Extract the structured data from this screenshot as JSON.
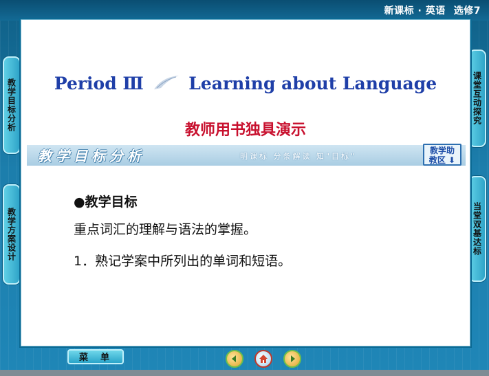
{
  "header": {
    "course": "新课标 · 英语",
    "module": "选修7"
  },
  "side_tabs": {
    "left": [
      "教学目标分析",
      "教学方案设计"
    ],
    "right": [
      "课堂互动探究",
      "当堂双基达标"
    ]
  },
  "slide": {
    "title_left": "Period Ⅲ",
    "title_right": "Learning about Language",
    "subtitle": "教师用书独具演示",
    "section_title": "教学目标分析",
    "section_hint": "明课标  分条解读  知\"目标\"",
    "assist_button": [
      "教学助",
      "教区 ⬇"
    ],
    "goal_heading": "●教学目标",
    "goal_line": "重点词汇的理解与语法的掌握。",
    "goal_item": "1．熟记学案中所列出的单词和短语。"
  },
  "footer": {
    "menu_label": "菜单"
  },
  "colors": {
    "accent": "#1f3fa8",
    "red": "#c8102e",
    "frame": "#1f7aa6"
  }
}
